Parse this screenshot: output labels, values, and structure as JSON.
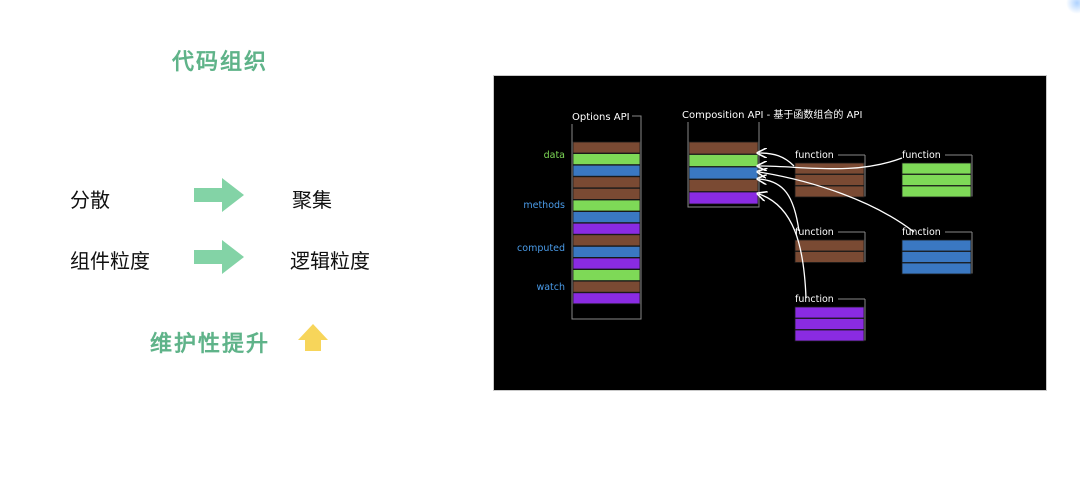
{
  "title": "代码组织",
  "rows": [
    {
      "from": "分散",
      "to": "聚集"
    },
    {
      "from": "组件粒度",
      "to": "逻辑粒度"
    }
  ],
  "bottom_label": "维护性提升",
  "icons": {
    "right_arrow": "arrow-right-icon",
    "up_arrow": "arrow-up-icon"
  },
  "colors": {
    "accent_green": "#5fb389",
    "arrow_green": "#83d3a6",
    "arrow_yellow": "#f7d55a",
    "panel_bg": "#000000",
    "brown": "#7a4a33",
    "green": "#7ed957",
    "blue": "#3a78c2",
    "purple": "#8a2be2",
    "label_green": "#7ed957",
    "label_blue": "#4a9be8"
  },
  "diagram": {
    "options_title": "Options API",
    "composition_title": "Composition API - 基于函数组合的 API",
    "option_labels": [
      "data",
      "methods",
      "computed",
      "watch"
    ],
    "options_stack": [
      "brown",
      "green",
      "blue",
      "brown",
      "brown",
      "green",
      "blue",
      "purple",
      "brown",
      "blue",
      "purple",
      "green",
      "brown",
      "purple"
    ],
    "composition_stack": [
      "brown",
      "green",
      "blue",
      "brown",
      "purple"
    ],
    "function_label": "function",
    "functions": [
      {
        "name": "function",
        "stack": [
          "brown",
          "brown",
          "brown"
        ]
      },
      {
        "name": "function",
        "stack": [
          "green",
          "green",
          "green"
        ]
      },
      {
        "name": "function",
        "stack": [
          "brown",
          "brown"
        ]
      },
      {
        "name": "function",
        "stack": [
          "blue",
          "blue",
          "blue"
        ]
      },
      {
        "name": "function",
        "stack": [
          "purple",
          "purple",
          "purple"
        ]
      }
    ],
    "carousel_dots": 3,
    "active_dot": 0
  }
}
